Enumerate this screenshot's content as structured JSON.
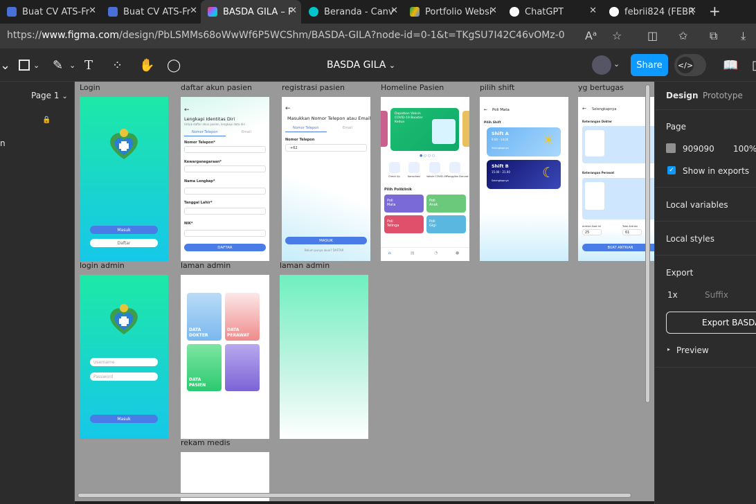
{
  "browser": {
    "tabs": [
      {
        "label": "Buat CV ATS-Fr",
        "icon": "doc-icon",
        "color": "#4a6fd8"
      },
      {
        "label": "Buat CV ATS-Fr",
        "icon": "doc-icon",
        "color": "#4a6fd8"
      },
      {
        "label": "BASDA GILA – F",
        "icon": "figma-icon",
        "color": "#f24e1e",
        "active": true
      },
      {
        "label": "Beranda - Canv",
        "icon": "canva-icon",
        "color": "#00c4cc"
      },
      {
        "label": "Portfolio Websi",
        "icon": "drive-icon",
        "color": "#f4b400"
      },
      {
        "label": "ChatGPT",
        "icon": "chatgpt-icon",
        "color": "#ffffff"
      },
      {
        "label": "febrii824 (FEBR",
        "icon": "github-icon",
        "color": "#ffffff"
      }
    ],
    "new_tab": "+",
    "url_prefix": "https://",
    "url_host": "www.figma.com",
    "url_path": "/design/PbLSMMs68oWwWf6P5WCShm/BASDA-GILA?node-id=0-1&t=TKgSU7I42C46vOMz-0"
  },
  "toolbar": {
    "document_name": "BASDA GILA",
    "share_label": "Share",
    "devmode_label": "</>"
  },
  "left_panel": {
    "page_label": "Page 1",
    "partial_text": "n"
  },
  "frames": [
    {
      "label": "Login"
    },
    {
      "label": "daftar akun pasien"
    },
    {
      "label": "registrasi pasien"
    },
    {
      "label": "Homeline Pasien"
    },
    {
      "label": "pilih shift"
    },
    {
      "label": "yg bertugas"
    },
    {
      "label": "login admin"
    },
    {
      "label": "laman admin"
    },
    {
      "label": "laman admin"
    },
    {
      "label": "rekam medis"
    }
  ],
  "login": {
    "masuk": "Masuk",
    "daftar": "Daftar"
  },
  "login_admin": {
    "username": "Username",
    "password": "Password",
    "masuk": "Masuk"
  },
  "daftar": {
    "title": "Lengkapi Identitas Diri",
    "subtitle": "Untuk daftar akun pasien, lengkapi data diri",
    "tab1": "Nomor Telepon",
    "tab2": "Email",
    "label_phone": "Nomor Telepon*",
    "label_nationality": "Kewarganegaraan*",
    "label_name": "Nama Lengkap*",
    "label_dob": "Tanggal Lahir*",
    "label_nik": "NIK*",
    "button": "DAFTAR"
  },
  "registrasi": {
    "title": "Masukkan Nomor Telepon atau Email",
    "tab1": "Nomor Telepon",
    "tab2": "Email",
    "label": "Nomor Telepon",
    "prefix": "+62",
    "button": "MASUK",
    "footer": "Belum punya akun? DAFTAR"
  },
  "homeline": {
    "banner_title": "Dapatkan Vaksin COVID-19 Booster Kedua",
    "section": "Pilih Poliklinik",
    "polis": [
      {
        "name": "Poli Mata",
        "color": "#7a6ad8"
      },
      {
        "name": "Poli Anak",
        "color": "#6ac97a"
      },
      {
        "name": "Poli Telinga",
        "color": "#e0506a"
      },
      {
        "name": "Poli Gigi",
        "color": "#5ab8e0"
      }
    ],
    "menus": [
      "Check Up",
      "Konsultasi",
      "Vaksin COVID-19",
      "Panggilan Darurat"
    ]
  },
  "shift": {
    "title": "Poli Mata",
    "section": "Pilih Shift",
    "shift_a": "Shift A",
    "shift_a_time": "9.00 - 14.00",
    "shift_b": "Shift B",
    "shift_b_time": "15.00 - 21.00",
    "selengkapnya": "Selengkapnya"
  },
  "bertugas": {
    "title": "Selengkapnya",
    "dokter": "Keterangan Dokter",
    "perawat": "Keterangan Perawat",
    "antrian_saat_ini": "Antrian Saat Ini",
    "total_antrian": "Total Antrian",
    "val_saat_ini": "25",
    "val_total": "61",
    "button": "BUAT ANTRIAN"
  },
  "admin": {
    "data_dokter": "DATA DOKTER",
    "data_perawat": "DATA PERAWAT",
    "data_pasien": "DATA PASIEN"
  },
  "right_panel": {
    "tab_design": "Design",
    "tab_prototype": "Prototype",
    "page_section": "Page",
    "page_color": "909090",
    "page_opacity": "100%",
    "show_in_exports": "Show in exports",
    "local_variables": "Local variables",
    "local_styles": "Local styles",
    "export_section": "Export",
    "export_scale": "1x",
    "export_suffix": "Suffix",
    "export_button": "Export BASDA",
    "preview": "Preview"
  }
}
